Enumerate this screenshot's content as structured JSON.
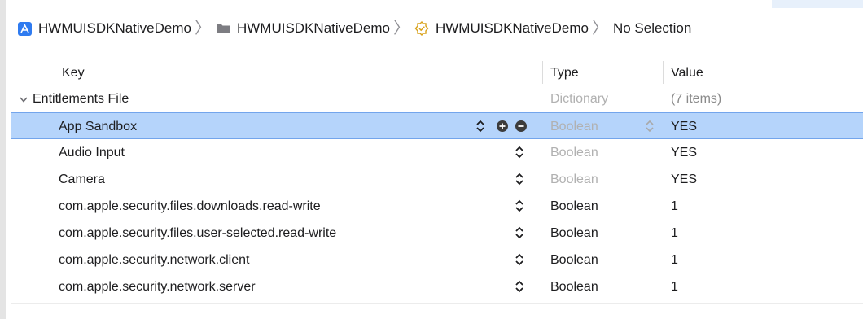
{
  "breadcrumb": {
    "project": "HWMUISDKNativeDemo",
    "group": "HWMUISDKNativeDemo",
    "file": "HWMUISDKNativeDemo",
    "selection": "No Selection"
  },
  "table": {
    "headers": {
      "key": "Key",
      "type": "Type",
      "value": "Value"
    },
    "root": {
      "key": "Entitlements File",
      "type": "Dictionary",
      "value": "(7 items)"
    },
    "rows": [
      {
        "key": "App Sandbox",
        "type": "Boolean",
        "value": "YES"
      },
      {
        "key": "Audio Input",
        "type": "Boolean",
        "value": "YES"
      },
      {
        "key": "Camera",
        "type": "Boolean",
        "value": "YES"
      },
      {
        "key": "com.apple.security.files.downloads.read-write",
        "type": "Boolean",
        "value": "1"
      },
      {
        "key": "com.apple.security.files.user-selected.read-write",
        "type": "Boolean",
        "value": "1"
      },
      {
        "key": "com.apple.security.network.client",
        "type": "Boolean",
        "value": "1"
      },
      {
        "key": "com.apple.security.network.server",
        "type": "Boolean",
        "value": "1"
      }
    ]
  },
  "colors": {
    "selection": "#b5d4fb",
    "accent": "#2f7bf0",
    "seal": "#d9a21b"
  }
}
